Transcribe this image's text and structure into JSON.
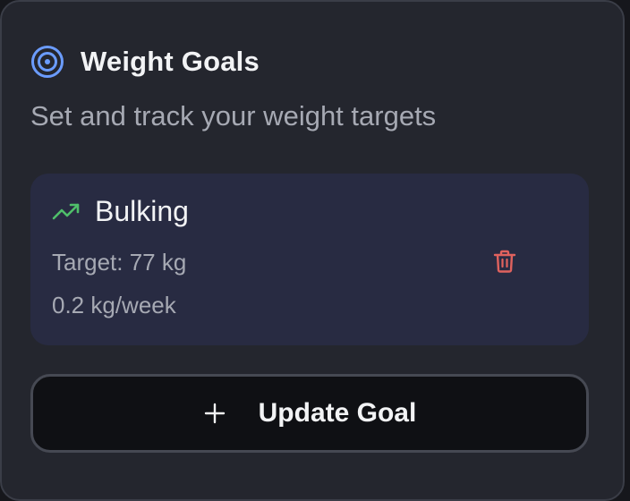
{
  "card": {
    "icon": "target-icon",
    "title": "Weight Goals",
    "subtitle": "Set and track your weight targets"
  },
  "goal": {
    "icon": "trending-up-icon",
    "name": "Bulking",
    "target": "Target: 77 kg",
    "rate": "0.2 kg/week",
    "delete_icon": "trash-icon"
  },
  "actions": {
    "update_icon": "plus-icon",
    "update_label": "Update Goal"
  },
  "colors": {
    "accent_blue": "#6b9cff",
    "trend_green": "#4fbf6a",
    "delete_red": "#e0625e",
    "card_bg": "#24262e",
    "goal_bg": "#282b42"
  }
}
